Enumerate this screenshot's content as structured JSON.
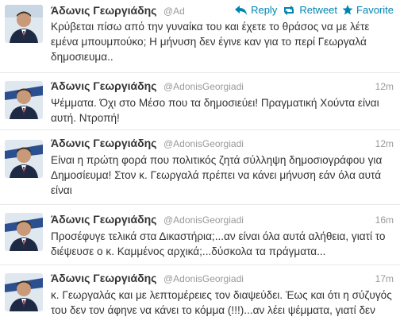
{
  "tweets": [
    {
      "name": "Άδωνις Γεωργιάδης",
      "handle": "@Ad",
      "time": "",
      "text": "Κρύβεται πίσω από την γυναίκα του και έχετε το θράσος να με λέτε εμένα μπουμπούκο; Η μήνυση δεν έγινε καν για το περί Γεωργαλά δημοσιευμα..",
      "actions": {
        "reply": "Reply",
        "retweet": "Retweet",
        "favorite": "Favorite"
      }
    },
    {
      "name": "Άδωνις Γεωργιάδης",
      "handle": "@AdonisGeorgiadi",
      "time": "12m",
      "text": "Ψέμματα. Όχι στο Μέσο που τα δημοσιεύει! Πραγματική Χούντα είναι αυτή. Ντροπή!"
    },
    {
      "name": "Άδωνις Γεωργιάδης",
      "handle": "@AdonisGeorgiadi",
      "time": "12m",
      "text": "Είναι η πρώτη φορά που πολιτικός ζητά σύλληψη δημοσιογράφου για Δημοσίευμα! Στον κ. Γεωργαλά πρέπει να κάνει μήνυση εάν όλα αυτά είναι"
    },
    {
      "name": "Άδωνις Γεωργιάδης",
      "handle": "@AdonisGeorgiadi",
      "time": "16m",
      "text": "Προσέφυγε τελικά στα Δικαστήρια;...αν είναι όλα αυτά αλήθεια, γιατί το διέψευσε ο κ. Καμμένος αρχικά;...δύσκολα τα πράγματα..."
    },
    {
      "name": "Άδωνις Γεωργιάδης",
      "handle": "@AdonisGeorgiadi",
      "time": "17m",
      "text": "κ. Γεωργαλάς και με λεπτομέρειες τον διαψεύδει. Έως και ότι η σύζυγός του δεν τον άφηνε να κάνει το κόμμα (!!!)...αν λέει ψέμματα, γιατί δεν"
    }
  ],
  "colors": {
    "link": "#0084b4",
    "meta": "#999999",
    "text": "#333333",
    "divider": "#e8e8e8"
  },
  "icons": [
    "reply-icon",
    "retweet-icon",
    "favorite-icon"
  ]
}
